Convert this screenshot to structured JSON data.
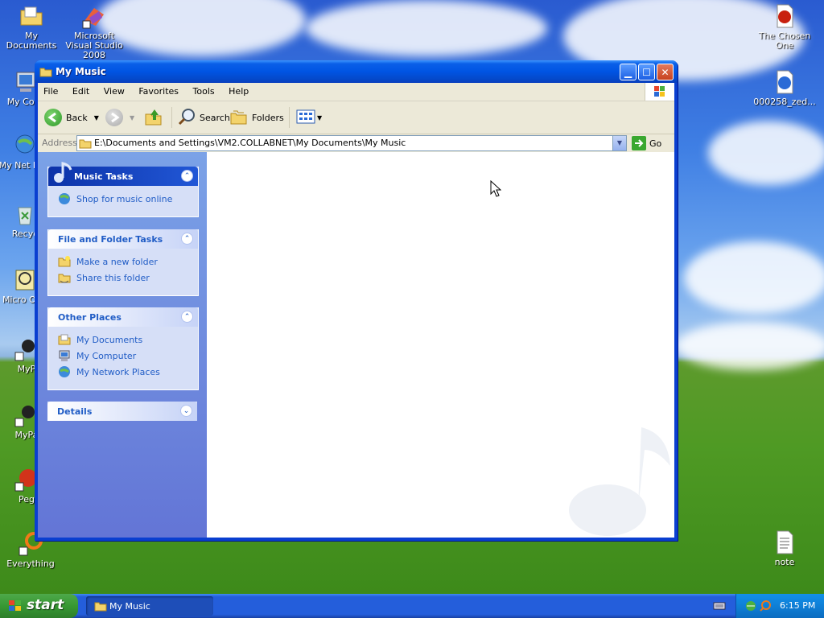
{
  "desktop": {
    "icons_left": [
      {
        "label": "My Documents",
        "icon": "folder-documents-icon"
      },
      {
        "label": "Microsoft Visual Studio 2008",
        "icon": "visual-studio-icon"
      },
      {
        "label": "My Com",
        "icon": "my-computer-icon"
      },
      {
        "label": "My Net Plac",
        "icon": "network-places-icon"
      },
      {
        "label": "Recyc",
        "icon": "recycle-bin-icon"
      },
      {
        "label": "Micro Outl",
        "icon": "outlook-icon"
      },
      {
        "label": "MyP",
        "icon": "shortcut-icon"
      },
      {
        "label": "MyPa",
        "icon": "shortcut-icon"
      },
      {
        "label": "Peg",
        "icon": "shortcut-icon"
      },
      {
        "label": "Everything",
        "icon": "search-shortcut-icon"
      }
    ],
    "icons_right": [
      {
        "label": "The Chosen One",
        "icon": "media-file-icon"
      },
      {
        "label": "000258_zed...",
        "icon": "audio-file-icon"
      },
      {
        "label": "note",
        "icon": "text-file-icon"
      }
    ]
  },
  "window": {
    "title": "My Music",
    "menu": [
      "File",
      "Edit",
      "View",
      "Favorites",
      "Tools",
      "Help"
    ],
    "toolbar": {
      "back": "Back",
      "search": "Search",
      "folders": "Folders"
    },
    "address": {
      "label": "Address",
      "value": "E:\\Documents and Settings\\VM2.COLLABNET\\My Documents\\My Music",
      "go": "Go"
    },
    "panels": {
      "music_tasks": {
        "title": "Music Tasks",
        "items": [
          "Shop for music online"
        ]
      },
      "file_folder_tasks": {
        "title": "File and Folder Tasks",
        "items": [
          "Make a new folder",
          "Share this folder"
        ]
      },
      "other_places": {
        "title": "Other Places",
        "items": [
          "My Documents",
          "My Computer",
          "My Network Places"
        ]
      },
      "details": {
        "title": "Details"
      }
    }
  },
  "taskbar": {
    "start_label": "start",
    "task_label": "My Music",
    "clock": "6:15 PM"
  },
  "colors": {
    "title_blue": "#0054e3",
    "link_blue": "#215dc6",
    "start_green": "#379833"
  }
}
